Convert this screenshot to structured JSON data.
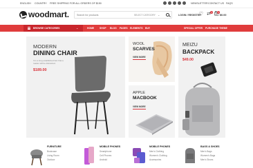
{
  "topbar": {
    "language": "ENGLISH",
    "currency": "COUNTRY",
    "shipping": "FREE SHIPPING FOR ALL ORDERS OF $150",
    "newsletter": "NEWSLETTER",
    "contact": "CONTACT US",
    "faqs": "FAQS"
  },
  "header": {
    "logo": "woodmart.",
    "search_placeholder": "Search for products",
    "category_select": "SELECT CATEGORY",
    "login": "LOGIN / REGISTER",
    "compare_count": "0",
    "cart_count": "0",
    "cart_total": "$0.00"
  },
  "nav": {
    "browse": "BROWSE CATEGORIES",
    "items": [
      "HOME",
      "SHOP",
      "BLOG",
      "PAGES",
      "ELEMENTS",
      "BUY"
    ],
    "right_items": [
      "SPECIAL OFFER",
      "PURCHASE THEME"
    ]
  },
  "banners": {
    "chair": {
      "pre": "MODERN",
      "title": "DINING CHAIR",
      "desc": "It is a long established fact that a reader will be distracted.",
      "price": "$189.00"
    },
    "scarf": {
      "pre": "WOOL",
      "title": "SCARVES",
      "link": "VIEW MORE"
    },
    "mac": {
      "pre": "APPLE",
      "title": "MACBOOK",
      "link": "VIEW MORE"
    },
    "backpack": {
      "pre": "MEIZU",
      "title": "BACKPACK",
      "price": "$49.00"
    }
  },
  "categories": [
    {
      "title": "FURNITURE",
      "items": [
        "Bookcase",
        "Living Room",
        "Outdoor"
      ]
    },
    {
      "title": "MOBILE PHONES",
      "items": [
        "Smartphone",
        "Cell Phones",
        "Android"
      ]
    },
    {
      "title": "MOBILE PHONES",
      "items": [
        "Men's Clothing",
        "Women's Clothing",
        "Accessories"
      ]
    },
    {
      "title": "BAGS & SHOES",
      "items": [
        "Men's Bags",
        "Women's Bags",
        "Men's Shoes"
      ]
    }
  ],
  "colors": {
    "accent": "#e03c3c",
    "accent_dark": "#c9262c",
    "price": "#d9353c"
  },
  "icons": [
    "search-icon",
    "heart-icon",
    "compare-icon",
    "cart-icon",
    "facebook-icon",
    "twitter-icon",
    "instagram-icon",
    "pinterest-icon",
    "youtube-icon",
    "menu-icon"
  ]
}
